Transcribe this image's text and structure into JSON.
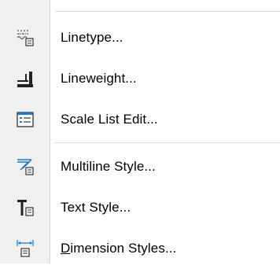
{
  "menu": {
    "items": [
      {
        "label": "Linetype...",
        "icon": "linetype-icon"
      },
      {
        "label": "Lineweight...",
        "icon": "lineweight-icon"
      },
      {
        "label": "Scale List Edit...",
        "icon": "scale-list-icon"
      },
      {
        "label": "Multiline Style...",
        "icon": "multiline-style-icon"
      },
      {
        "label": "Text Style...",
        "icon": "text-style-icon"
      },
      {
        "label_accel": "D",
        "label_rest": "imension Styles...",
        "icon": "dimension-styles-icon"
      }
    ]
  },
  "colors": {
    "gutter": "#f0f0f0",
    "separator": "#d8d8d8",
    "icon_blue": "#1e78c8",
    "icon_dark": "#333333"
  }
}
